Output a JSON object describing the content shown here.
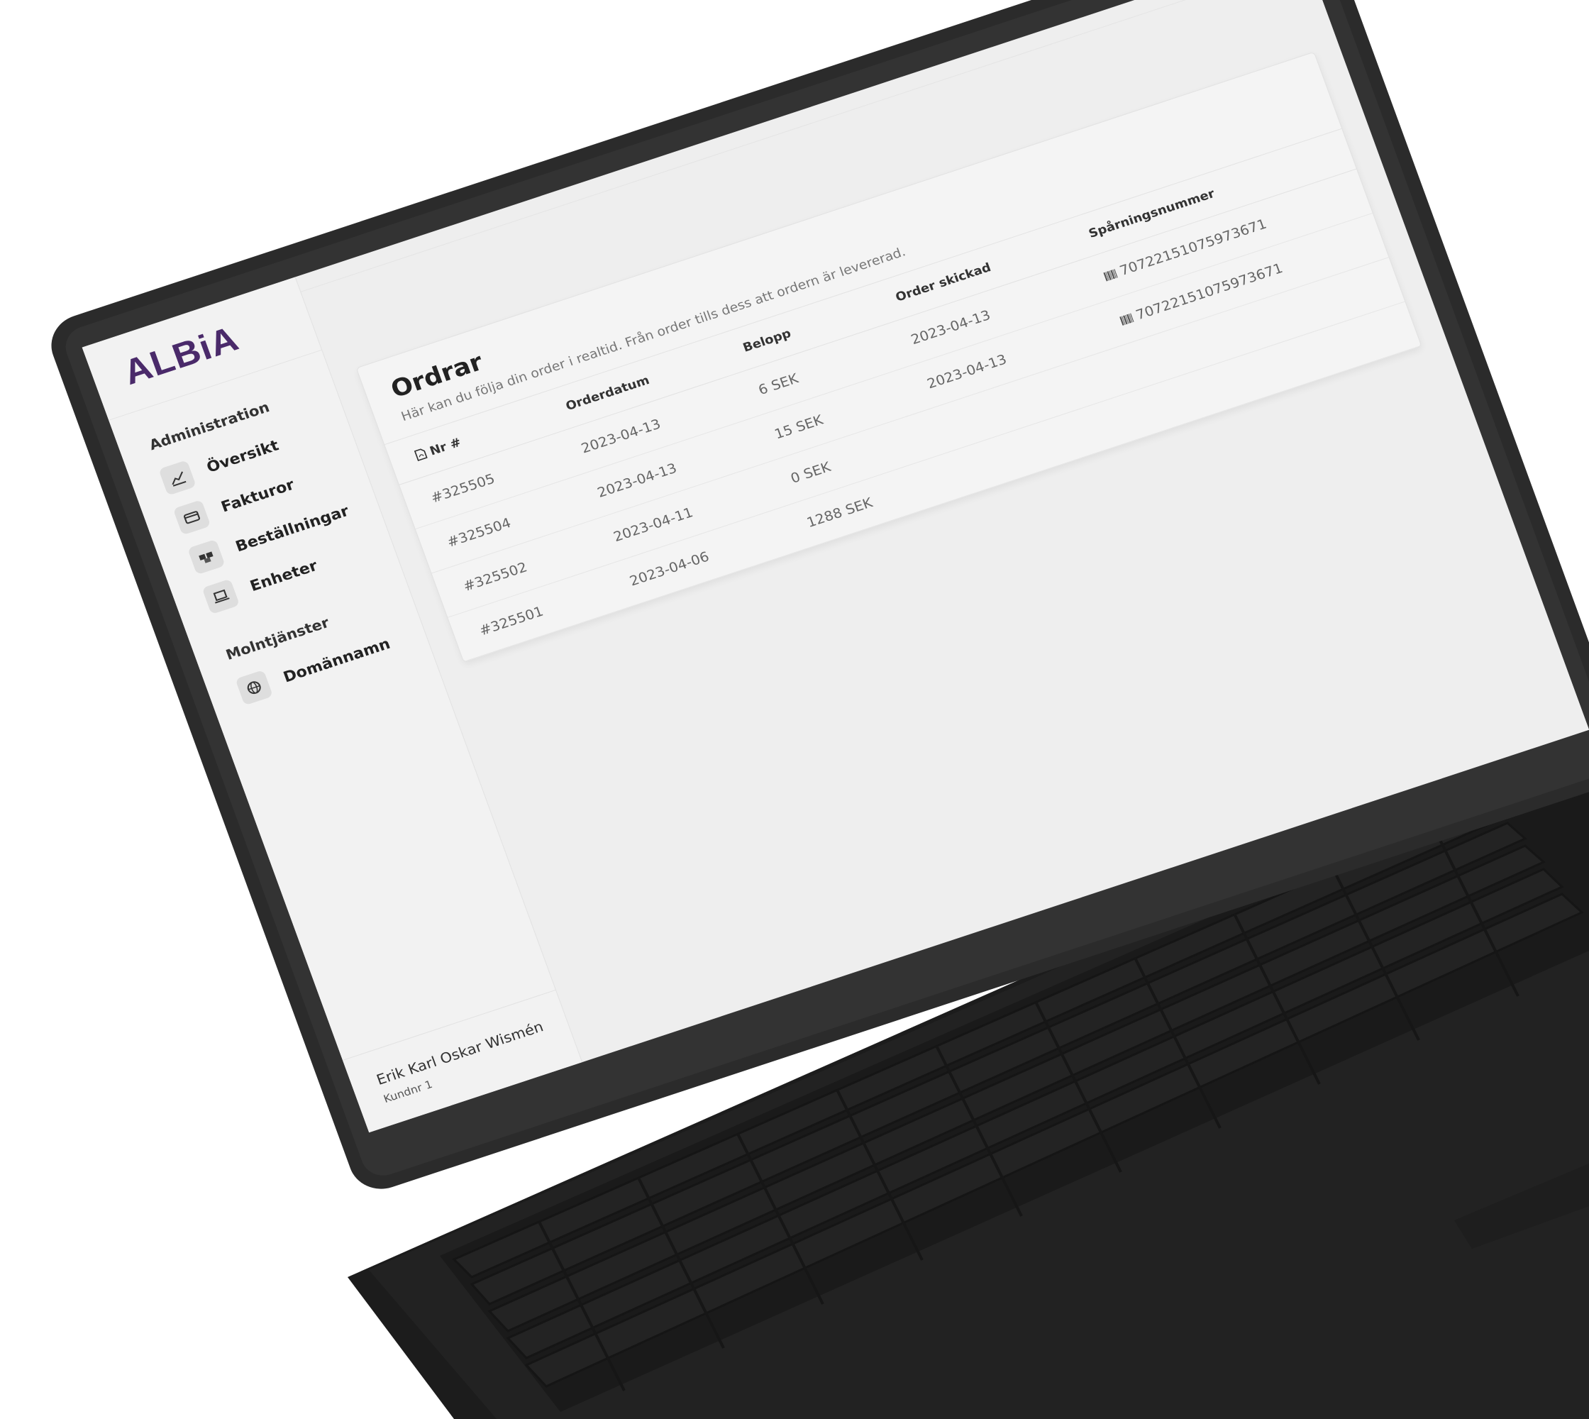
{
  "brand": {
    "logo_text": "ALBiA",
    "accent_color": "#4a2a6a"
  },
  "sidebar": {
    "sections": [
      {
        "heading": "Administration",
        "items": [
          {
            "label": "Översikt",
            "icon": "chart-line-icon"
          },
          {
            "label": "Fakturor",
            "icon": "credit-card-icon"
          },
          {
            "label": "Beställningar",
            "icon": "boxes-icon"
          },
          {
            "label": "Enheter",
            "icon": "laptop-icon"
          }
        ]
      },
      {
        "heading": "Molntjänster",
        "items": [
          {
            "label": "Domännamn",
            "icon": "globe-icon"
          }
        ]
      }
    ],
    "user": {
      "name": "Erik Karl Oskar Wismén",
      "customer_no": "Kundnr 1"
    }
  },
  "orders": {
    "title": "Ordrar",
    "subtitle": "Här kan du följa din order i realtid. Från order tills dess att ordern är levererad.",
    "columns": [
      "Nr #",
      "Orderdatum",
      "Belopp",
      "Order skickad",
      "Spårningsnummer"
    ],
    "rows": [
      {
        "nr": "#325505",
        "date": "2023-04-13",
        "amount": "6 SEK",
        "shipped": "2023-04-13",
        "tracking": "70722151075973671"
      },
      {
        "nr": "#325504",
        "date": "2023-04-13",
        "amount": "15 SEK",
        "shipped": "2023-04-13",
        "tracking": "70722151075973671"
      },
      {
        "nr": "#325502",
        "date": "2023-04-11",
        "amount": "0 SEK",
        "shipped": "",
        "tracking": ""
      },
      {
        "nr": "#325501",
        "date": "2023-04-06",
        "amount": "1288 SEK",
        "shipped": "",
        "tracking": ""
      }
    ]
  }
}
